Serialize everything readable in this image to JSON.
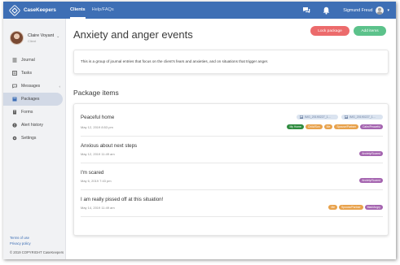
{
  "app": {
    "brand": "CaseKeepers"
  },
  "nav": {
    "links": [
      {
        "label": "Clients",
        "active": true
      },
      {
        "label": "Help/FAQs",
        "active": false
      }
    ],
    "user_name": "Sigmund Freud",
    "icons": [
      "chat-icon",
      "bell-icon",
      "user-avatar-icon",
      "caret-down-icon"
    ]
  },
  "sidebar": {
    "profile": {
      "name": "Claire Voyant",
      "role": "Client"
    },
    "items": [
      {
        "label": "Journal",
        "icon": "journal-icon"
      },
      {
        "label": "Tasks",
        "icon": "tasks-icon"
      },
      {
        "label": "Messages",
        "icon": "messages-icon",
        "has_submenu": true
      },
      {
        "label": "Packages",
        "icon": "packages-icon",
        "active": true
      },
      {
        "label": "Forms",
        "icon": "forms-icon"
      },
      {
        "label": "Alert history",
        "icon": "alert-icon"
      },
      {
        "label": "Settings",
        "icon": "settings-icon"
      }
    ],
    "footer": {
      "terms": "Terms of use",
      "privacy": "Privacy policy",
      "copyright": "© 2019 COPYRIGHT CaseKeepers"
    }
  },
  "main": {
    "title": "Anxiety and anger events",
    "buttons": {
      "lock": "Lock package",
      "add": "Add items"
    },
    "description": "This is a group of journal entries that focus on the client's fears and anxieties, and on situations that trigger anger.",
    "section_title": "Package items",
    "items": [
      {
        "title": "Peaceful home",
        "date": "May 12, 2019 8:53 pm",
        "attachments": [
          "IMG_20190227_1...",
          "IMG_20190227_1..."
        ],
        "tags": [
          {
            "label": "My Home",
            "color": "#2e8b3e"
          },
          {
            "label": "Child/Son",
            "color": "#e8a24c"
          },
          {
            "label": "Me",
            "color": "#e8a24c"
          },
          {
            "label": "Spouse/Partner",
            "color": "#e8a24c"
          },
          {
            "label": "Calm/Peaceful",
            "color": "#a565b0"
          }
        ]
      },
      {
        "title": "Anxious about next steps",
        "date": "May 12, 2019 11:49 am",
        "attachments": [],
        "tags": [
          {
            "label": "Anxiety/Scared",
            "color": "#a565b0"
          }
        ]
      },
      {
        "title": "I'm scared",
        "date": "May 6, 2019 7:43 pm",
        "attachments": [],
        "tags": [
          {
            "label": "Anxiety/Scared",
            "color": "#a565b0"
          }
        ]
      },
      {
        "title": "I am really pissed off at this situation!",
        "date": "May 14, 2019 11:49 am",
        "attachments": [],
        "tags": [
          {
            "label": "Me",
            "color": "#e8a24c"
          },
          {
            "label": "Spouse/Partner",
            "color": "#e8a24c"
          },
          {
            "label": "Mad/Angry",
            "color": "#a565b0"
          }
        ]
      }
    ]
  },
  "colors": {
    "navbar": "#3e6fb5",
    "lock_button": "#ec6b6c",
    "add_button": "#5cc28b",
    "active_menu": "#d2d9e6"
  }
}
